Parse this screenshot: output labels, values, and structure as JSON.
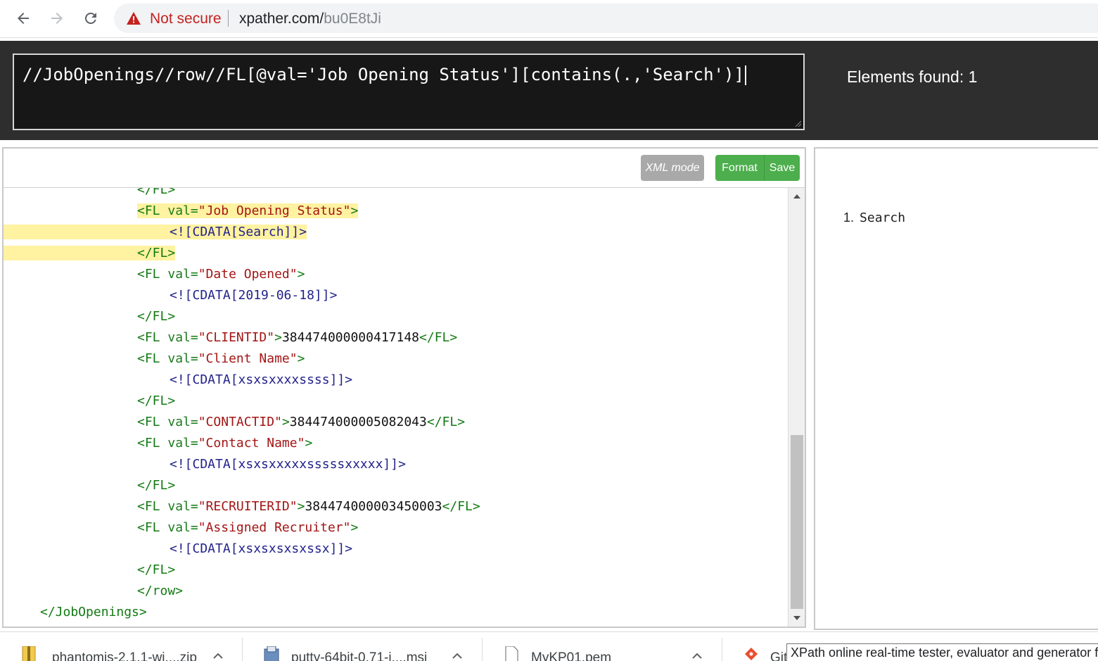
{
  "browser": {
    "security_label": "Not secure",
    "url_host": "xpather.com/",
    "url_path": "bu0E8tJi"
  },
  "query": {
    "value": "//JobOpenings//row//FL[@val='Job Opening Status'][contains(.,'Search')]",
    "found_label": "Elements found: 1"
  },
  "toolbar": {
    "xml_mode_label": "XML mode",
    "format_label": "Format",
    "save_label": "Save"
  },
  "code": {
    "lines": [
      "</FL>",
      "<FL val=\"Job Opening Status\">",
      "<![CDATA[Search]]>",
      "</FL>",
      "<FL val=\"Date Opened\">",
      "<![CDATA[2019-06-18]]>",
      "</FL>",
      "<FL val=\"CLIENTID\">384474000000417148</FL>",
      "<FL val=\"Client Name\">",
      "<![CDATA[xsxsxxxxssss]]>",
      "</FL>",
      "<FL val=\"CONTACTID\">384474000005082043</FL>",
      "<FL val=\"Contact Name\">",
      "<![CDATA[xsxsxxxxxsssssxxxxx]]>",
      "</FL>",
      "<FL val=\"RECRUITERID\">384474000003450003</FL>",
      "<FL val=\"Assigned Recruiter\">",
      "<![CDATA[xsxsxsxsxssx]]>",
      "</FL>",
      "</row>",
      "</JobOpenings>"
    ]
  },
  "results": {
    "items": [
      {
        "num": "1.",
        "text": "Search"
      }
    ]
  },
  "downloads": {
    "items": [
      {
        "name": "phantomjs-2.1.1-wi....zip",
        "icon": "zip-file-icon"
      },
      {
        "name": "putty-64bit-0.71-i....msi",
        "icon": "installer-file-icon"
      },
      {
        "name": "MyKP01.pem",
        "icon": "document-file-icon"
      },
      {
        "name": "Git",
        "icon": "git-icon"
      }
    ]
  },
  "tooltip": {
    "text": "XPath online real-time tester, evaluator and generator fo"
  },
  "colors": {
    "dark_bar": "#2e2e2e",
    "accent_green": "#4cae4c",
    "highlight": "#fff2a0",
    "tag": "#137a13",
    "string": "#a31515",
    "cdata": "#22228c",
    "warning": "#c5221f"
  }
}
